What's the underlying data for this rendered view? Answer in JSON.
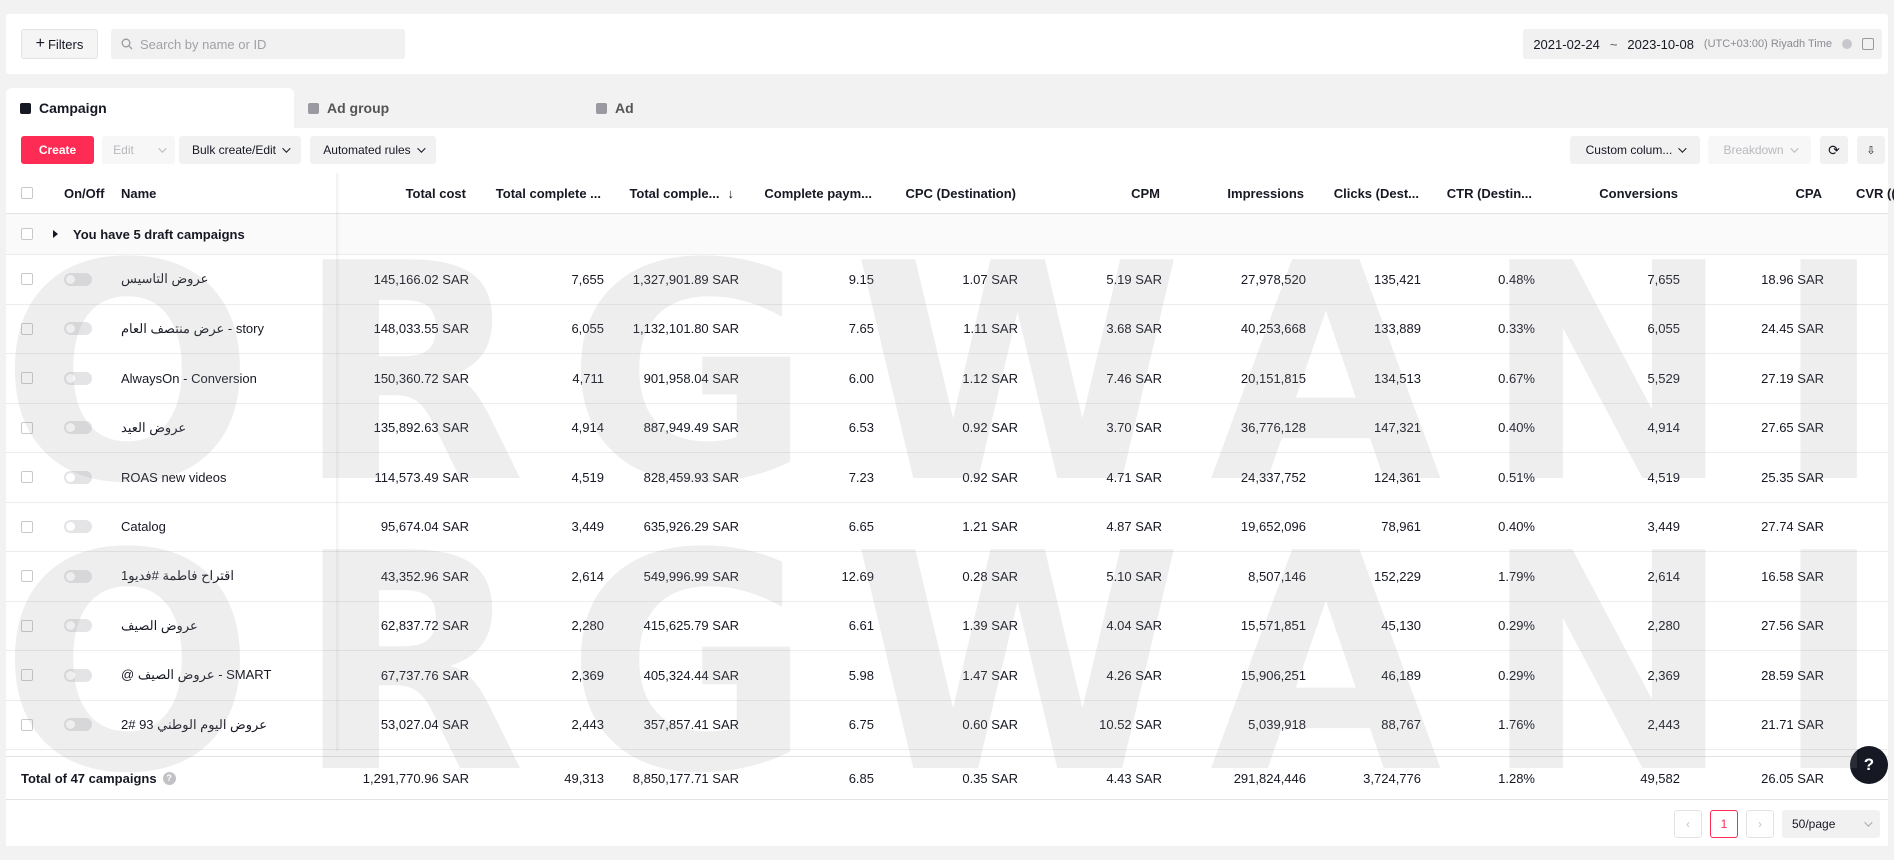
{
  "topbar": {
    "filters_label": "Filters",
    "search_placeholder": "Search by name or ID",
    "date_start": "2021-02-24",
    "date_sep": "~",
    "date_end": "2023-10-08",
    "timezone": "(UTC+03:00) Riyadh Time"
  },
  "tabs": [
    {
      "label": "Campaign",
      "active": true
    },
    {
      "label": "Ad group",
      "active": false
    },
    {
      "label": "Ad",
      "active": false
    }
  ],
  "toolbar": {
    "create": "Create",
    "edit": "Edit",
    "bulk": "Bulk create/Edit",
    "rules": "Automated rules",
    "custom_columns": "Custom colum...",
    "breakdown": "Breakdown"
  },
  "columns": {
    "onoff": "On/Off",
    "name": "Name",
    "total_cost": "Total cost",
    "total_complete_a": "Total complete ...",
    "total_complete_b": "Total comple...",
    "complete_payment": "Complete paym...",
    "cpc": "CPC (Destination)",
    "cpm": "CPM",
    "impressions": "Impressions",
    "clicks": "Clicks (Dest...",
    "ctr": "CTR (Destin...",
    "conversions": "Conversions",
    "cpa": "CPA",
    "cvr": "CVR (("
  },
  "draft_row": "You have 5 draft campaigns",
  "rows": [
    {
      "name": "عروض التاسيس",
      "cost": "145,166.02 SAR",
      "tc": "7,655",
      "tcv": "1,327,901.89 SAR",
      "cp": "9.15",
      "cpc": "1.07 SAR",
      "cpm": "5.19 SAR",
      "imp": "27,978,520",
      "clicks": "135,421",
      "ctr": "0.48%",
      "conv": "7,655",
      "cpa": "18.96 SAR"
    },
    {
      "name": "عرض منتصف العام - story",
      "cost": "148,033.55 SAR",
      "tc": "6,055",
      "tcv": "1,132,101.80 SAR",
      "cp": "7.65",
      "cpc": "1.11 SAR",
      "cpm": "3.68 SAR",
      "imp": "40,253,668",
      "clicks": "133,889",
      "ctr": "0.33%",
      "conv": "6,055",
      "cpa": "24.45 SAR"
    },
    {
      "name": "AlwaysOn - Conversion",
      "cost": "150,360.72 SAR",
      "tc": "4,711",
      "tcv": "901,958.04 SAR",
      "cp": "6.00",
      "cpc": "1.12 SAR",
      "cpm": "7.46 SAR",
      "imp": "20,151,815",
      "clicks": "134,513",
      "ctr": "0.67%",
      "conv": "5,529",
      "cpa": "27.19 SAR"
    },
    {
      "name": "عروض العيد",
      "cost": "135,892.63 SAR",
      "tc": "4,914",
      "tcv": "887,949.49 SAR",
      "cp": "6.53",
      "cpc": "0.92 SAR",
      "cpm": "3.70 SAR",
      "imp": "36,776,128",
      "clicks": "147,321",
      "ctr": "0.40%",
      "conv": "4,914",
      "cpa": "27.65 SAR"
    },
    {
      "name": "ROAS new videos",
      "cost": "114,573.49 SAR",
      "tc": "4,519",
      "tcv": "828,459.93 SAR",
      "cp": "7.23",
      "cpc": "0.92 SAR",
      "cpm": "4.71 SAR",
      "imp": "24,337,752",
      "clicks": "124,361",
      "ctr": "0.51%",
      "conv": "4,519",
      "cpa": "25.35 SAR"
    },
    {
      "name": "Catalog",
      "cost": "95,674.04 SAR",
      "tc": "3,449",
      "tcv": "635,926.29 SAR",
      "cp": "6.65",
      "cpc": "1.21 SAR",
      "cpm": "4.87 SAR",
      "imp": "19,652,096",
      "clicks": "78,961",
      "ctr": "0.40%",
      "conv": "3,449",
      "cpa": "27.74 SAR"
    },
    {
      "name": "اقتراح فاطمة #فديو1",
      "cost": "43,352.96 SAR",
      "tc": "2,614",
      "tcv": "549,996.99 SAR",
      "cp": "12.69",
      "cpc": "0.28 SAR",
      "cpm": "5.10 SAR",
      "imp": "8,507,146",
      "clicks": "152,229",
      "ctr": "1.79%",
      "conv": "2,614",
      "cpa": "16.58 SAR"
    },
    {
      "name": "عروض الصيف",
      "cost": "62,837.72 SAR",
      "tc": "2,280",
      "tcv": "415,625.79 SAR",
      "cp": "6.61",
      "cpc": "1.39 SAR",
      "cpm": "4.04 SAR",
      "imp": "15,571,851",
      "clicks": "45,130",
      "ctr": "0.29%",
      "conv": "2,280",
      "cpa": "27.56 SAR"
    },
    {
      "name": "@ عروض الصيف - SMART",
      "cost": "67,737.76 SAR",
      "tc": "2,369",
      "tcv": "405,324.44 SAR",
      "cp": "5.98",
      "cpc": "1.47 SAR",
      "cpm": "4.26 SAR",
      "imp": "15,906,251",
      "clicks": "46,189",
      "ctr": "0.29%",
      "conv": "2,369",
      "cpa": "28.59 SAR"
    },
    {
      "name": "عروض اليوم الوطني 93 #2",
      "cost": "53,027.04 SAR",
      "tc": "2,443",
      "tcv": "357,857.41 SAR",
      "cp": "6.75",
      "cpc": "0.60 SAR",
      "cpm": "10.52 SAR",
      "imp": "5,039,918",
      "clicks": "88,767",
      "ctr": "1.76%",
      "conv": "2,443",
      "cpa": "21.71 SAR"
    }
  ],
  "total": {
    "label": "Total of 47 campaigns",
    "cost": "1,291,770.96 SAR",
    "tc": "49,313",
    "tcv": "8,850,177.71 SAR",
    "cp": "6.85",
    "cpc": "0.35 SAR",
    "cpm": "4.43 SAR",
    "imp": "291,824,446",
    "clicks": "3,724,776",
    "ctr": "1.28%",
    "conv": "49,582",
    "cpa": "26.05 SAR"
  },
  "pagination": {
    "current_page": "1",
    "per_page": "50/page"
  },
  "watermark": "ORGWANI",
  "colors": {
    "accent": "#fe2c55"
  }
}
